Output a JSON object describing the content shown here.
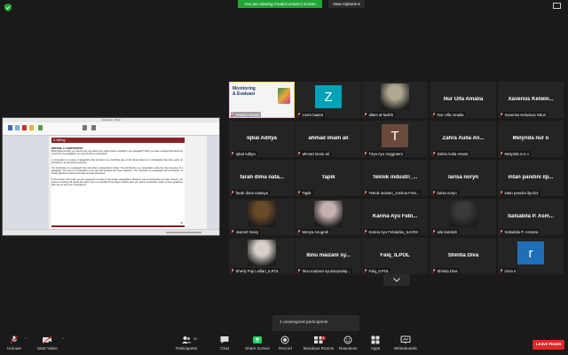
{
  "banner": {
    "text": "You are viewing Amalul Umam's screen"
  },
  "view_options": {
    "label": "View Options ▾"
  },
  "shared_doc": {
    "window_title": "Dokumen1 - Word",
    "section_title": "5. Writing",
    "subhead": "WRITING A COMPOSITION",
    "para1": "What happens when you need to say more about your subject than is possible in one paragraph? When you have a subject that cannot be covered in one paragraph, you need to write a composition.",
    "para2": "A composition is a group of paragraphs that tell about one controlling idea or the thesis statement. A composition has three parts: an introduction, a body and a conclusion.",
    "para3": "The introduction is a paragraph that tells what a composition is about. The introduction to a composition is like the topic sentence of a paragraph. The body of a composition is the part that develops the thesis statement. The conclusion is a paragraph that summarizes, or clearly signals an ending to the idea you have developed.",
    "para4": "In this section of the book, you are supposed to be able to write longer compositions. Whatever type of composition you write, however, the process of writing will remain the same. Here is a checklist of the steps to follow when you write a composition. Refer to these guidelines often as you write your compositions.",
    "page_no": "30"
  },
  "tiles": [
    {
      "label": "Amalul Umam",
      "big_name": "",
      "kind": "slide",
      "active": true
    },
    {
      "label": "zoom baa04",
      "big_name": "",
      "kind": "avatar",
      "letter": "Z",
      "color": "#00a2b8"
    },
    {
      "label": "allam al-fasihh",
      "big_name": "",
      "kind": "photo",
      "photo_color": "#b0a890"
    },
    {
      "label": "Nur Ulfa Amalia",
      "big_name": "Nur Ulfa Amalia",
      "kind": "name"
    },
    {
      "label": "Xaverius Kelwinus Ndori",
      "big_name": "Xaverius  Kelwin...",
      "kind": "name"
    },
    {
      "label": "Iqbal Aditya",
      "big_name": "Iqbal Aditya",
      "kind": "name"
    },
    {
      "label": "ahmad imam ali",
      "big_name": "ahmad imam ali",
      "kind": "name"
    },
    {
      "label": "Triya Ayu Anggraeni",
      "big_name": "",
      "kind": "avatar",
      "letter": "T",
      "color": "#6b4a3c"
    },
    {
      "label": "Zahra Aulia Anwar",
      "big_name": "Zahra Aulia An...",
      "kind": "name"
    },
    {
      "label": "Melynda nur o",
      "big_name": "Melynda nur o",
      "kind": "name"
    },
    {
      "label": "farah dima natasya",
      "big_name": "farah dima nata...",
      "kind": "name"
    },
    {
      "label": "Tapik",
      "big_name": "Tapik",
      "kind": "name"
    },
    {
      "label": "Teknik industri_Joshua Fran...",
      "big_name": "Teknik industri_...",
      "kind": "name"
    },
    {
      "label": "larisa noryn",
      "big_name": "larisa noryn",
      "kind": "name"
    },
    {
      "label": "intan pandini ilpol12",
      "big_name": "intan pandini ilp...",
      "kind": "name"
    },
    {
      "label": "Jeanett Seviy",
      "big_name": "",
      "kind": "photo",
      "photo_color": "#6a4a28"
    },
    {
      "label": "Mesya Anugrah",
      "big_name": "",
      "kind": "photo",
      "photo_color": "#c8b0b0"
    },
    {
      "label": "Karina Ayu Febianka_ILKOM",
      "big_name": "Karina Ayu Febi...",
      "kind": "name"
    },
    {
      "label": "aila kamilah",
      "big_name": "",
      "kind": "photo",
      "photo_color": "#3a3a3a"
    },
    {
      "label": "Salsabila P. Asmara",
      "big_name": "Salsabila P. Asm...",
      "kind": "name"
    },
    {
      "label": "Sherly Puji Leillari_ILPOL",
      "big_name": "",
      "kind": "photo",
      "photo_color": "#d8d0c8"
    },
    {
      "label": "Ibnu maizani syurianysahp...",
      "big_name": "Ibnu maizani sy...",
      "kind": "name"
    },
    {
      "label": "Faiq_ILPOL",
      "big_name": "Faiq_ILPOL",
      "kind": "name"
    },
    {
      "label": "Shintia Diva",
      "big_name": "Shintia Diva",
      "kind": "name"
    },
    {
      "label": "rizna n",
      "big_name": "",
      "kind": "avatar",
      "letter": "r",
      "color": "#1f6fb8"
    }
  ],
  "slide_tile": {
    "line1": "Monitoring",
    "line2": "& Evaluasi"
  },
  "unassigned": {
    "text": "4 unassigned participants"
  },
  "toolbar": {
    "unmute": "Unmute",
    "start_video": "Start Video",
    "participants": "Participants",
    "participants_count": "30",
    "chat": "Chat",
    "share_screen": "Share Screen",
    "record": "Record",
    "breakout_rooms": "Breakout Rooms",
    "breakout_count": "4",
    "reactions": "Reactions",
    "apps": "Apps",
    "whiteboards": "Whiteboards",
    "leave": "Leave Room"
  },
  "colors": {
    "banner_green": "#23a537",
    "leave_red": "#e02828",
    "active_outline": "#f5d33a",
    "share_green": "#23d160",
    "mute_red": "#e02828"
  }
}
